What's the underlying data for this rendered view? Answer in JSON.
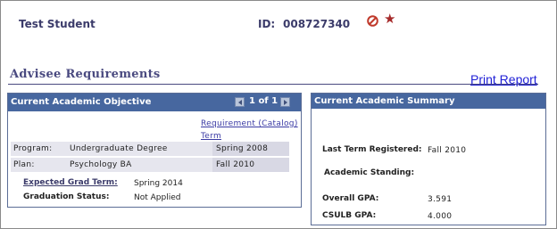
{
  "header": {
    "student_name": "Test Student",
    "id_label": "ID:",
    "id_value": "008727340",
    "icons": [
      "no-entry-icon",
      "star-icon"
    ],
    "colors": {
      "service_indicator": "#c0392b",
      "star": "#a52a2a",
      "text": "#3b3b6a"
    }
  },
  "page": {
    "title": "Advisee Requirements",
    "print_link": "Print Report"
  },
  "objective_panel": {
    "title": "Current Academic Objective",
    "nav_count": "1 of 1",
    "link_requirement": "Requirement (Catalog)",
    "link_term": "Term",
    "rows": [
      {
        "label": "Program:",
        "value": "Undergraduate Degree",
        "term": "Spring 2008"
      },
      {
        "label": "Plan:",
        "value": "Psychology BA",
        "term": "Fall 2010"
      }
    ],
    "expected_grad_label": "Expected Grad Term:",
    "expected_grad_value": "Spring 2014",
    "grad_status_label": "Graduation Status:",
    "grad_status_value": "Not Applied",
    "header_color": "#47679f"
  },
  "summary_panel": {
    "title": "Current Academic Summary",
    "last_term_label": "Last Term Registered:",
    "last_term_value": "Fall 2010",
    "standing_label": "Academic Standing:",
    "standing_value": "",
    "overall_gpa_label": "Overall GPA:",
    "overall_gpa_value": "3.591",
    "csulb_gpa_label": "CSULB GPA:",
    "csulb_gpa_value": "4.000"
  }
}
